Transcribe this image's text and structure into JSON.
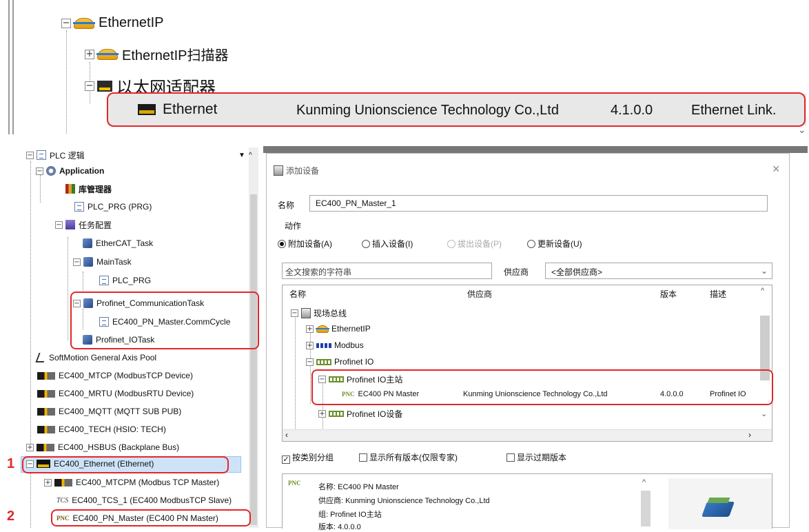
{
  "top_tree": {
    "ethernetip": "EthernetIP",
    "ethernetip_scanner": "EthernetIP扫描器",
    "ethernet_adapter": "以太网适配器",
    "device": {
      "name": "Ethernet",
      "vendor": "Kunming Unionscience Technology Co.,Ltd",
      "version": "4.1.0.0",
      "description": "Ethernet Link."
    }
  },
  "project_tree": {
    "plc_logic": "PLC 逻辑",
    "application": "Application",
    "library_manager": "库管理器",
    "plc_prg": "PLC_PRG (PRG)",
    "task_config": "任务配置",
    "ethercat_task": "EtherCAT_Task",
    "main_task": "MainTask",
    "main_task_prg": "PLC_PRG",
    "profinet_comm_task": "Profinet_CommunicationTask",
    "profinet_comm_cycle": "EC400_PN_Master.CommCycle",
    "profinet_io_task": "Profinet_IOTask",
    "softmotion": "SoftMotion General Axis Pool",
    "mtcp": "EC400_MTCP (ModbusTCP Device)",
    "mrtu": "EC400_MRTU (ModbusRTU Device)",
    "mqtt": "EC400_MQTT (MQTT SUB PUB)",
    "tech": "EC400_TECH (HSIO: TECH)",
    "hsbus": "EC400_HSBUS (Backplane Bus)",
    "ethernet": "EC400_Ethernet (Ethernet)",
    "mtcpm": "EC400_MTCPM (Modbus TCP Master)",
    "tcs": "EC400_TCS_1 (EC400 ModbusTCP Slave)",
    "pn_master": "EC400_PN_Master (EC400 PN Master)",
    "tcs_badge": "TCS",
    "pnc_badge": "PNC"
  },
  "markers": {
    "one": "1",
    "two": "2"
  },
  "dialog": {
    "title": "添加设备",
    "close": "×",
    "name_label": "名称",
    "name_value": "EC400_PN_Master_1",
    "action_label": "动作",
    "actions": [
      "附加设备(A)",
      "插入设备(I)",
      "拔出设备(P)",
      "更新设备(U)"
    ],
    "search_placeholder": "全文搜索的字符串",
    "vendor_label": "供应商",
    "vendor_value": "<全部供应商>",
    "columns": [
      "名称",
      "供应商",
      "版本",
      "描述"
    ],
    "tree": {
      "fieldbus": "现场总线",
      "ethernetip": "EthernetIP",
      "modbus": "Modbus",
      "profinet_io": "Profinet IO",
      "profinet_master_group": "Profinet IO主站",
      "pn_master": {
        "name": "EC400 PN Master",
        "vendor": "Kunming Unionscience Technology Co.,Ltd",
        "version": "4.0.0.0",
        "description": "Profinet IO"
      },
      "profinet_device": "Profinet IO设备"
    },
    "options": [
      "按类别分组",
      "显示所有版本(仅限专家)",
      "显示过期版本"
    ],
    "info": {
      "badge": "PNC",
      "name_line": "名称: EC400 PN Master",
      "vendor_line": "供应商: Kunming Unionscience Technology Co.,Ltd",
      "group_line": "组: Profinet IO主站",
      "version_line": "版本: 4.0.0.0"
    }
  }
}
